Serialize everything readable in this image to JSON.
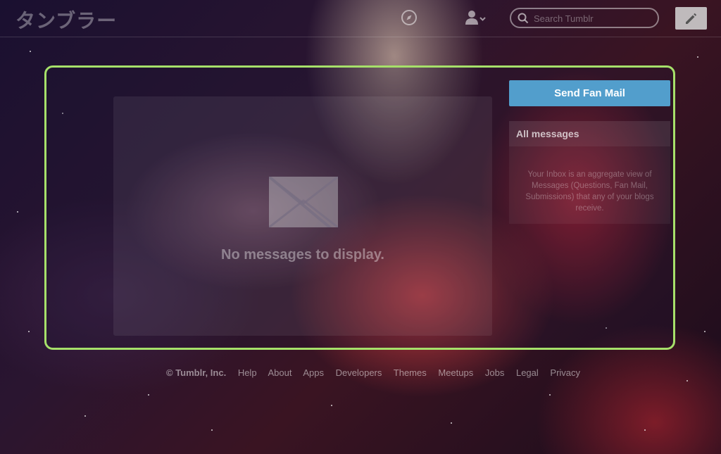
{
  "header": {
    "logo": "タンブラー",
    "search": {
      "placeholder": "Search Tumblr",
      "value": ""
    },
    "icons": {
      "explore": "compass-icon",
      "account": "account-icon",
      "search": "search-icon",
      "compose": "pencil-icon"
    }
  },
  "main": {
    "empty_message": "No messages to display.",
    "empty_icon": "envelope-icon"
  },
  "sidebar": {
    "send_fan_mail_label": "Send Fan Mail",
    "filter_label": "All messages",
    "description": "Your Inbox is an aggregate view of Messages (Questions, Fan Mail, Submissions) that any of your blogs receive."
  },
  "footer": {
    "copyright": "© Tumblr, Inc.",
    "links": [
      "Help",
      "About",
      "Apps",
      "Developers",
      "Themes",
      "Meetups",
      "Jobs",
      "Legal",
      "Privacy"
    ]
  },
  "colors": {
    "accent_button": "#529ecc",
    "panel_border": "#a6e06a"
  }
}
